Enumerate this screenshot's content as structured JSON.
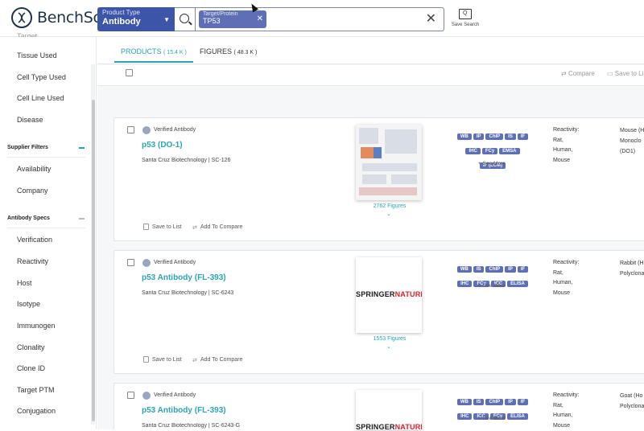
{
  "brand": {
    "name": "BenchSci"
  },
  "header": {
    "product_type_label": "Product Type",
    "product_type_value": "Antibody",
    "chip_label": "Target/Protein",
    "chip_value": "TP53",
    "save_search_label": "Save Search"
  },
  "sidebar": {
    "items_top": [
      "Tissue Used",
      "Cell Type Used",
      "Cell Line Used",
      "Disease"
    ],
    "supplier_heading": "Supplier Filters",
    "supplier_items": [
      "Availability",
      "Company"
    ],
    "antibody_heading": "Antibody Specs",
    "antibody_items": [
      "Verification",
      "Reactivity",
      "Host",
      "Isotype",
      "Immunogen",
      "Clonality",
      "Clone ID",
      "Target PTM",
      "Conjugation"
    ]
  },
  "tabs": {
    "products_label": "PRODUCTS",
    "products_count": "( 15.4 K )",
    "figures_label": "FIGURES",
    "figures_count": "( 48.3 K )"
  },
  "toolbar": {
    "compare_label": "Compare",
    "save_label": "Save to Li"
  },
  "colors": {
    "accent": "#2aa6b0",
    "tag": "#5e6fb5",
    "product_type_bg": "#3d55a8"
  },
  "cards": [
    {
      "verified": "Verified Antibody",
      "title": "p53 (DO-1)",
      "vendor": "Santa Cruz Biotechnology | SC-126",
      "save_to_list": "Save to List",
      "add_to_compare": "Add To Compare",
      "figures": "2762 Figures",
      "tags_row1": [
        "WB",
        "IP",
        "ChIP",
        "IS",
        "IF"
      ],
      "tags_row2": [
        "IHC",
        "FCy",
        "EMSA"
      ],
      "tags_row3": [
        "IF (LCM)"
      ],
      "see_more": "+ See More",
      "reactivity_label": "Reactivity:",
      "reactivity": [
        "Rat,",
        "Human,",
        "Mouse"
      ],
      "host": [
        "Mouse (H",
        "Monoclo",
        "(DO1)"
      ]
    },
    {
      "verified": "Verified Antibody",
      "title": "p53 Antibody (FL-393)",
      "vendor": "Santa Cruz Biotechnology | SC-6243",
      "save_to_list": "Save to List",
      "add_to_compare": "Add To Compare",
      "figures": "1553 Figures",
      "publisher_a": "SPRINGER",
      "publisher_b": "NATURE",
      "tags_row1": [
        "WB",
        "IS",
        "ChIP",
        "IP",
        "IF"
      ],
      "tags_row2": [
        "IHC",
        "FCy",
        "ICC",
        "ELISA"
      ],
      "see_more": "+ See More",
      "reactivity_label": "Reactivity:",
      "reactivity": [
        "Rat,",
        "Human,",
        "Mouse"
      ],
      "host": [
        "Rabbit (H",
        "Polyclona"
      ]
    },
    {
      "verified": "Verified Antibody",
      "title": "p53 Antibody (FL-393)",
      "vendor": "Santa Cruz Biotechnology | SC-6243-G",
      "publisher_a": "SPRINGER",
      "publisher_b": "NATURE",
      "tags_row1": [
        "WB",
        "IS",
        "ChIP",
        "IP",
        "IF"
      ],
      "tags_row2": [
        "IHC",
        "ICC",
        "FCy",
        "ELISA"
      ],
      "see_more": "+ See More",
      "reactivity_label": "Reactivity:",
      "reactivity": [
        "Rat,",
        "Human,",
        "Mouse"
      ],
      "host": [
        "Goat (Ho",
        "Polyclona"
      ]
    }
  ]
}
